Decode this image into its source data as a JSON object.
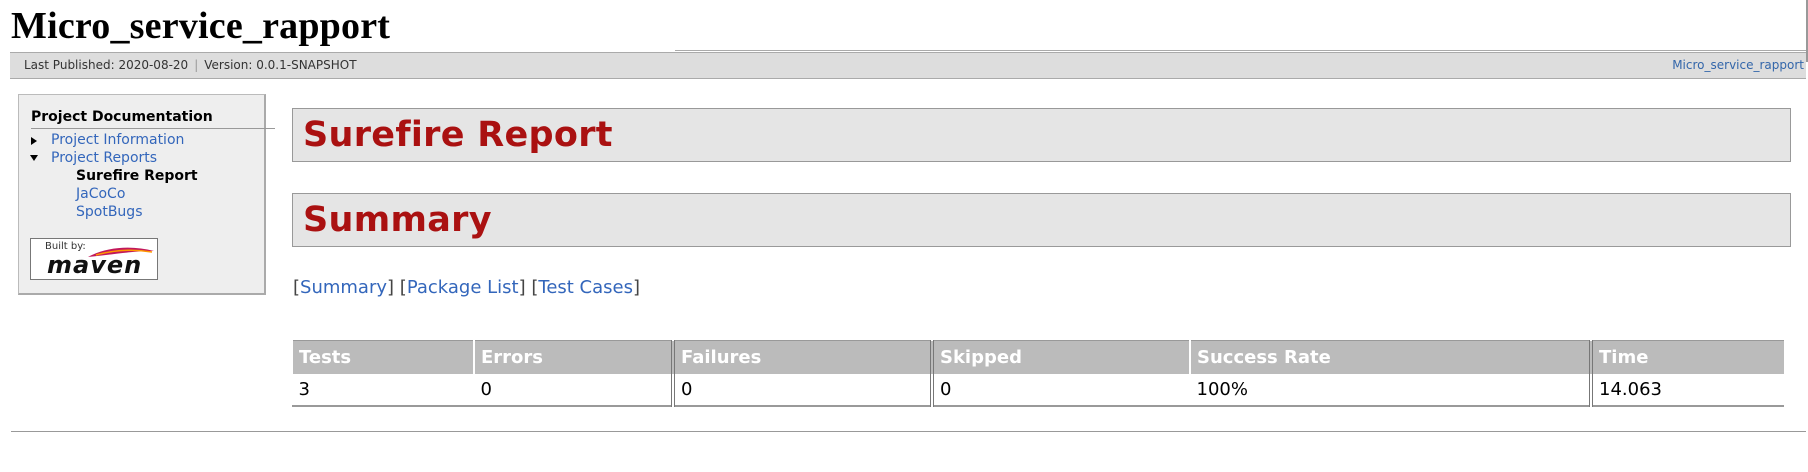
{
  "banner": {
    "title": "Micro_service_rapport"
  },
  "breadcrumbs": {
    "last_published": "Last Published: 2020-08-20",
    "separator": "|",
    "version": "Version: 0.0.1-SNAPSHOT",
    "right_link": "Micro_service_rapport"
  },
  "sidebar": {
    "heading": "Project Documentation",
    "items": [
      {
        "label": "Project Information",
        "state": "collapsed"
      },
      {
        "label": "Project Reports",
        "state": "expanded"
      },
      {
        "label": "Surefire Report",
        "state": "active"
      },
      {
        "label": "JaCoCo"
      },
      {
        "label": "SpotBugs"
      }
    ],
    "built_by": "Built by:",
    "maven": "maven"
  },
  "main": {
    "title": "Surefire Report",
    "summary_heading": "Summary",
    "nav_links": [
      "Summary",
      "Package List",
      "Test Cases"
    ]
  },
  "summary_table": {
    "headers": [
      "Tests",
      "Errors",
      "Failures",
      "Skipped",
      "Success Rate",
      "Time"
    ],
    "row": [
      "3",
      "0",
      "0",
      "0",
      "100%",
      "14.063"
    ]
  },
  "colors": {
    "heading_red": "#aa1111",
    "link_blue": "#3366bb",
    "table_header_bg": "#bbbbbb"
  }
}
